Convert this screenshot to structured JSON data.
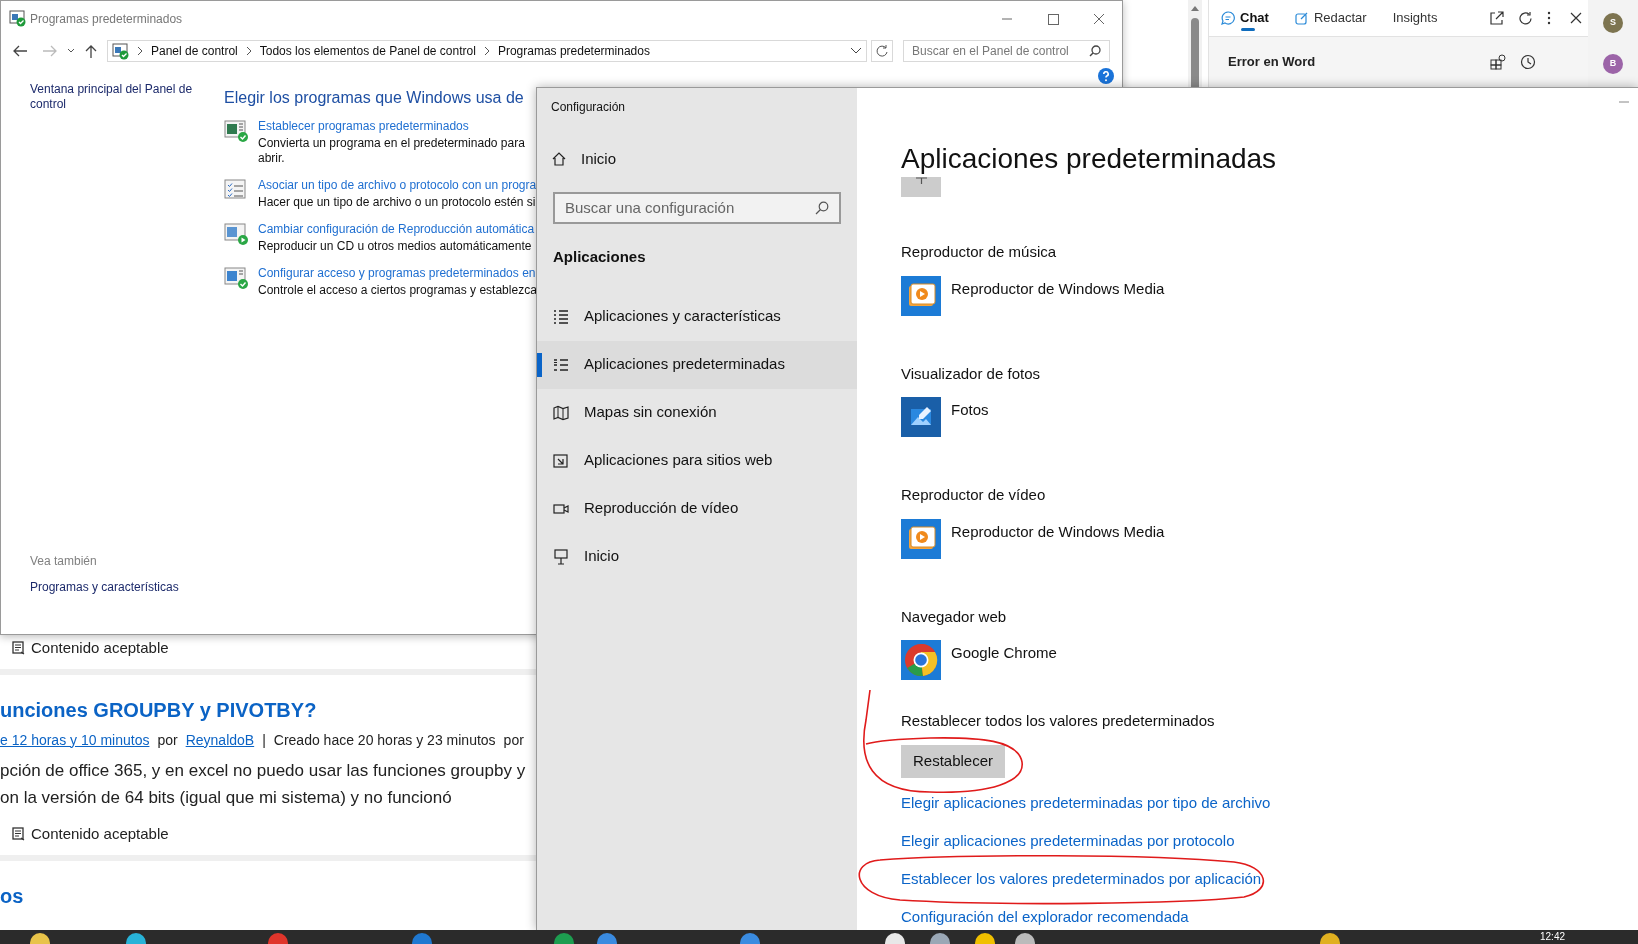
{
  "browser_page": {
    "blocks": [
      {
        "kind": "status",
        "text": "Contenido aceptable"
      },
      {
        "kind": "divider"
      },
      {
        "kind": "heading",
        "text": "unciones GROUPBY y PIVOTBY?"
      },
      {
        "kind": "meta",
        "parts": [
          {
            "text": "e 12 horas y 10 minutos",
            "link": true
          },
          {
            "text": "por",
            "link": false
          },
          {
            "text": "ReynaldoB",
            "link": true
          },
          {
            "text": "|",
            "link": false
          },
          {
            "text": "Creado hace 20 horas y 23 minutos",
            "link": false
          },
          {
            "text": "por",
            "link": false
          }
        ]
      },
      {
        "kind": "body",
        "text": "pción de office 365, y en excel no puedo usar las funciones groupby y"
      },
      {
        "kind": "body",
        "text": "on la versión de 64 bits (igual que mi sistema) y no funcionó"
      },
      {
        "kind": "status",
        "text": "Contenido aceptable"
      },
      {
        "kind": "divider"
      },
      {
        "kind": "heading",
        "text": "os"
      }
    ]
  },
  "control_panel": {
    "title": "Programas predeterminados",
    "breadcrumb": [
      "Panel de control",
      "Todos los elementos de Panel de control",
      "Programas predeterminados"
    ],
    "search_placeholder": "Buscar en el Panel de control",
    "sidebar_link": "Ventana principal del Panel de control",
    "see_also": {
      "heading": "Vea también",
      "links": [
        "Programas y características"
      ]
    },
    "heading": "Elegir los programas que Windows usa de",
    "tasks": [
      {
        "kind": "programs",
        "link": "Establecer programas predeterminados",
        "description": [
          "Convierta un programa en el predeterminado para",
          "abrir."
        ]
      },
      {
        "kind": "file-types",
        "link": "Asociar un tipo de archivo o protocolo con un progra",
        "description": [
          "Hacer que un tipo de archivo o un protocolo estén si"
        ]
      },
      {
        "kind": "autoplay",
        "link": "Cambiar configuración de Reproducción automática",
        "description": [
          "Reproducir un CD u otros medios automáticamente"
        ]
      },
      {
        "kind": "access",
        "link": "Configurar acceso y programas predeterminados en",
        "description": [
          "Controle el acceso a ciertos programas y establezca"
        ]
      }
    ]
  },
  "settings": {
    "title": "Configuración",
    "home": "Inicio",
    "search_placeholder": "Buscar una configuración",
    "section": "Aplicaciones",
    "nav": [
      {
        "kind": "list",
        "label": "Aplicaciones y características",
        "selected": false
      },
      {
        "kind": "defaults",
        "label": "Aplicaciones predeterminadas",
        "selected": true
      },
      {
        "kind": "map",
        "label": "Mapas sin conexión",
        "selected": false
      },
      {
        "kind": "web",
        "label": "Aplicaciones para sitios web",
        "selected": false
      },
      {
        "kind": "video",
        "label": "Reproducción de vídeo",
        "selected": false
      },
      {
        "kind": "startup",
        "label": "Inicio",
        "selected": false
      }
    ],
    "page_title": "Aplicaciones predeterminadas",
    "categories": [
      {
        "label": "Reproductor de música",
        "app": {
          "kind": "media-player",
          "name": "Reproductor de Windows Media"
        }
      },
      {
        "label": "Visualizador de fotos",
        "app": {
          "kind": "photos",
          "name": "Fotos"
        }
      },
      {
        "label": "Reproductor de vídeo",
        "app": {
          "kind": "media-player",
          "name": "Reproductor de Windows Media"
        }
      },
      {
        "label": "Navegador web",
        "app": {
          "kind": "browser",
          "name": "Google Chrome"
        }
      }
    ],
    "reset": {
      "label": "Restablecer todos los valores predeterminados",
      "button": "Restablecer"
    },
    "links": [
      "Elegir aplicaciones predeterminadas por tipo de archivo",
      "Elegir aplicaciones predeterminadas por protocolo",
      "Establecer los valores predeterminados por aplicación",
      "Configuración del explorador recomendada"
    ]
  },
  "assistant": {
    "tabs": [
      {
        "kind": "chat",
        "label": "Chat",
        "selected": true
      },
      {
        "kind": "compose",
        "label": "Redactar",
        "selected": false
      },
      {
        "kind": "plain",
        "label": "Insights",
        "selected": false
      }
    ],
    "title": "Error en Word",
    "avatars": [
      {
        "initial": "S",
        "color": "#7d7450"
      },
      {
        "initial": "B",
        "color": "#9c64a8"
      }
    ]
  },
  "taskbar": {
    "clock": "12:42"
  }
}
